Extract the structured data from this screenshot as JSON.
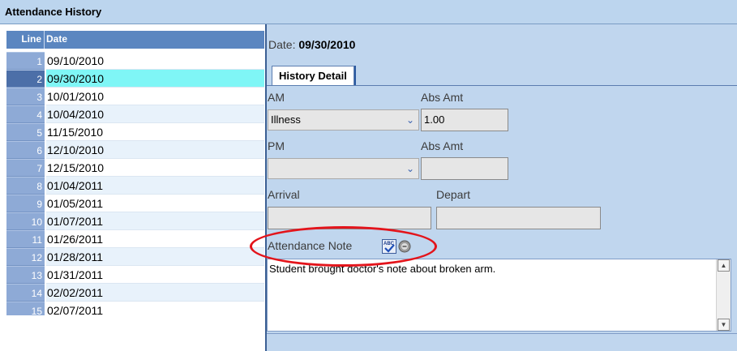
{
  "window": {
    "title": "Attendance History"
  },
  "grid": {
    "headers": {
      "line": "Line",
      "date": "Date"
    },
    "rows": [
      {
        "line": "1",
        "date": "09/10/2010"
      },
      {
        "line": "2",
        "date": "09/30/2010"
      },
      {
        "line": "3",
        "date": "10/01/2010"
      },
      {
        "line": "4",
        "date": "10/04/2010"
      },
      {
        "line": "5",
        "date": "11/15/2010"
      },
      {
        "line": "6",
        "date": "12/10/2010"
      },
      {
        "line": "7",
        "date": "12/15/2010"
      },
      {
        "line": "8",
        "date": "01/04/2011"
      },
      {
        "line": "9",
        "date": "01/05/2011"
      },
      {
        "line": "10",
        "date": "01/07/2011"
      },
      {
        "line": "11",
        "date": "01/26/2011"
      },
      {
        "line": "12",
        "date": "01/28/2011"
      },
      {
        "line": "13",
        "date": "01/31/2011"
      },
      {
        "line": "14",
        "date": "02/02/2011"
      },
      {
        "line": "15",
        "date": "02/07/2011"
      }
    ],
    "selected_line": "2"
  },
  "detail": {
    "date_label": "Date:",
    "date_value": "09/30/2010",
    "tab_label": "History Detail",
    "am_label": "AM",
    "am_value": "Illness",
    "am_abs_label": "Abs Amt",
    "am_abs_value": "1.00",
    "pm_label": "PM",
    "pm_value": "",
    "pm_abs_label": "Abs Amt",
    "pm_abs_value": "",
    "arrival_label": "Arrival",
    "arrival_value": "",
    "depart_label": "Depart",
    "depart_value": "",
    "note_label": "Attendance Note",
    "note_text": "Student brought doctor's note about broken arm.",
    "spell_icon_text": "ABC"
  },
  "icons": {
    "spellcheck": "spell-check-icon",
    "clear": "clear-circle-icon",
    "dropdown": "chevron-down-icon"
  },
  "colors": {
    "highlight": "#e3141b",
    "selected_row": "#7ff6f6",
    "header": "#5b86c0"
  }
}
